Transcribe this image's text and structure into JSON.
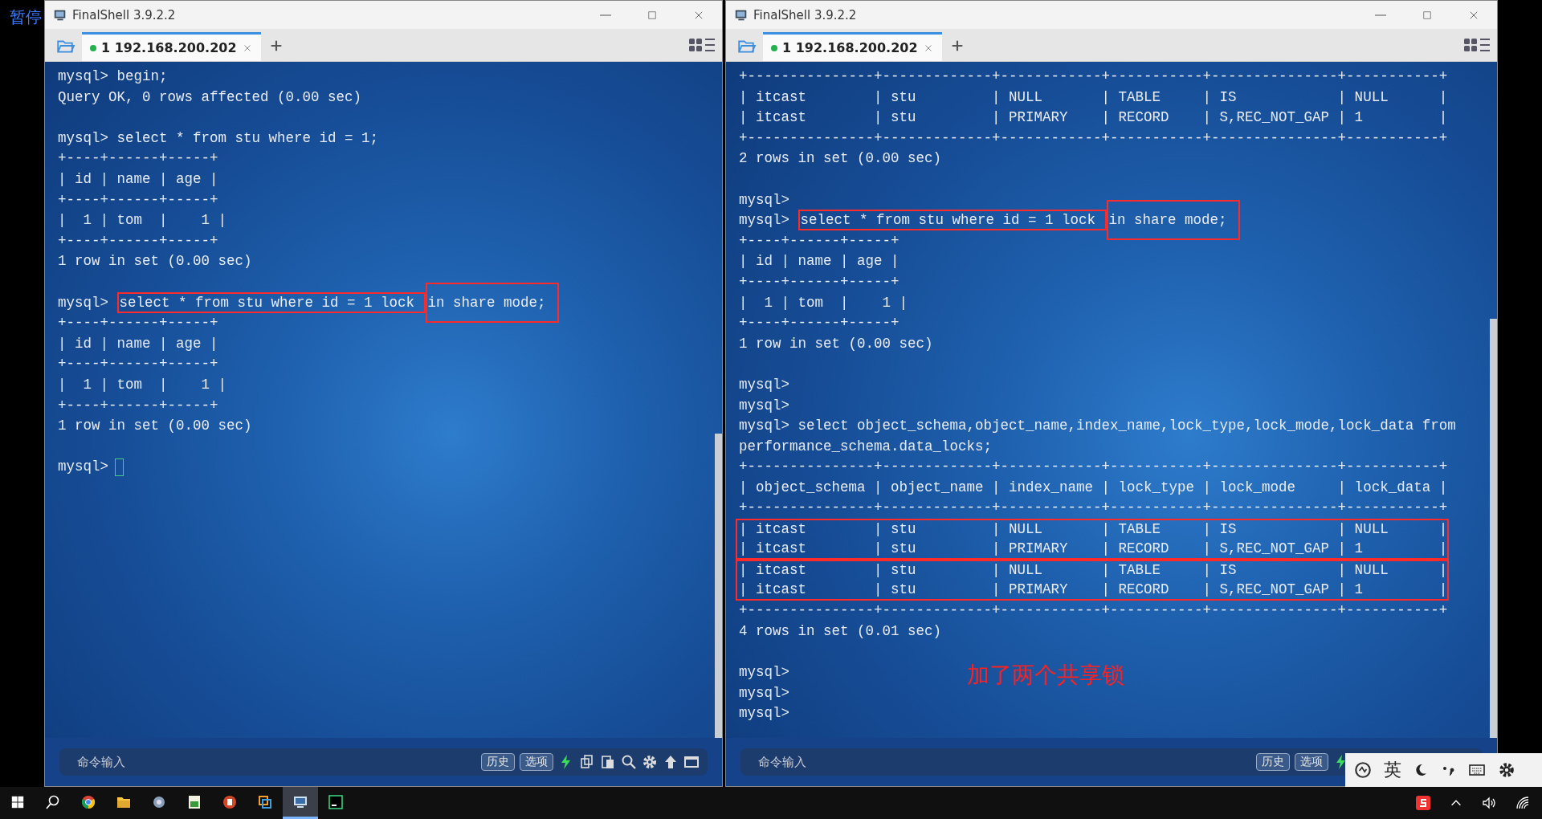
{
  "pause_label": "暂停",
  "windows": [
    {
      "title": "FinalShell 3.9.2.2",
      "tabs": [
        {
          "label": "1 192.168.200.202",
          "selected": true,
          "connected": true
        }
      ],
      "terminal": {
        "cursor": true,
        "lines": [
          {
            "kind": "text",
            "text": "mysql> begin;"
          },
          {
            "kind": "text",
            "text": "Query OK, 0 rows affected (0.00 sec)"
          },
          {
            "kind": "blank"
          },
          {
            "kind": "text",
            "text": "mysql> select * from stu where id = 1;"
          },
          {
            "kind": "text",
            "text": "+----+------+-----+"
          },
          {
            "kind": "text",
            "text": "| id | name | age |"
          },
          {
            "kind": "text",
            "text": "+----+------+-----+"
          },
          {
            "kind": "text",
            "text": "|  1 | tom  |    1 |"
          },
          {
            "kind": "text",
            "text": "+----+------+-----+"
          },
          {
            "kind": "text",
            "text": "1 row in set (0.00 sec)"
          },
          {
            "kind": "blank"
          },
          {
            "kind": "parts",
            "parts": [
              {
                "text": "mysql> ",
                "kind": "plain"
              },
              {
                "text": "select * from stu where id = 1 lock ",
                "kind": "box"
              },
              {
                "text": "in share mode;",
                "kind": "tall"
              }
            ]
          },
          {
            "kind": "text",
            "text": "+----+------+-----+"
          },
          {
            "kind": "text",
            "text": "| id | name | age |"
          },
          {
            "kind": "text",
            "text": "+----+------+-----+"
          },
          {
            "kind": "text",
            "text": "|  1 | tom  |    1 |"
          },
          {
            "kind": "text",
            "text": "+----+------+-----+"
          },
          {
            "kind": "text",
            "text": "1 row in set (0.00 sec)"
          },
          {
            "kind": "blank"
          },
          {
            "kind": "text",
            "text": "mysql>"
          }
        ]
      },
      "command_bar": {
        "placeholder": "命令输入",
        "buttons": [
          "历史",
          "选项"
        ]
      }
    },
    {
      "title": "FinalShell 3.9.2.2",
      "tabs": [
        {
          "label": "1 192.168.200.202",
          "selected": true,
          "connected": true
        }
      ],
      "terminal": {
        "annotation": "加了两个共享锁",
        "lines": [
          {
            "kind": "text",
            "text": "+---------------+-------------+------------+-----------+---------------+-----------+"
          },
          {
            "kind": "text",
            "text": "| itcast        | stu         | NULL       | TABLE     | IS            | NULL      |"
          },
          {
            "kind": "text",
            "text": "| itcast        | stu         | PRIMARY    | RECORD    | S,REC_NOT_GAP | 1         |"
          },
          {
            "kind": "text",
            "text": "+---------------+-------------+------------+-----------+---------------+-----------+"
          },
          {
            "kind": "text",
            "text": "2 rows in set (0.00 sec)"
          },
          {
            "kind": "blank"
          },
          {
            "kind": "text",
            "text": "mysql>"
          },
          {
            "kind": "parts",
            "parts": [
              {
                "text": "mysql> ",
                "kind": "plain"
              },
              {
                "text": "select * from stu where id = 1 lock ",
                "kind": "box"
              },
              {
                "text": "in share mode;",
                "kind": "tall"
              }
            ]
          },
          {
            "kind": "text",
            "text": "+----+------+-----+"
          },
          {
            "kind": "text",
            "text": "| id | name | age |"
          },
          {
            "kind": "text",
            "text": "+----+------+-----+"
          },
          {
            "kind": "text",
            "text": "|  1 | tom  |    1 |"
          },
          {
            "kind": "text",
            "text": "+----+------+-----+"
          },
          {
            "kind": "text",
            "text": "1 row in set (0.00 sec)"
          },
          {
            "kind": "blank"
          },
          {
            "kind": "text",
            "text": "mysql>"
          },
          {
            "kind": "text",
            "text": "mysql>"
          },
          {
            "kind": "text",
            "text": "mysql> select object_schema,object_name,index_name,lock_type,lock_mode,lock_data from"
          },
          {
            "kind": "text",
            "text": "performance_schema.data_locks;"
          },
          {
            "kind": "text",
            "text": "+---------------+-------------+------------+-----------+---------------+-----------+"
          },
          {
            "kind": "text",
            "text": "| object_schema | object_name | index_name | lock_type | lock_mode     | lock_data |"
          },
          {
            "kind": "text",
            "text": "+---------------+-------------+------------+-----------+---------------+-----------+"
          },
          {
            "kind": "boxed",
            "lines": [
              {
                "kind": "text",
                "text": "| itcast        | stu         | NULL       | TABLE     | IS            | NULL      |"
              },
              {
                "kind": "text",
                "text": "| itcast        | stu         | PRIMARY    | RECORD    | S,REC_NOT_GAP | 1         |"
              }
            ]
          },
          {
            "kind": "boxed",
            "lines": [
              {
                "kind": "text",
                "text": "| itcast        | stu         | NULL       | TABLE     | IS            | NULL      |"
              },
              {
                "kind": "text",
                "text": "| itcast        | stu         | PRIMARY    | RECORD    | S,REC_NOT_GAP | 1         |"
              }
            ]
          },
          {
            "kind": "text",
            "text": "+---------------+-------------+------------+-----------+---------------+-----------+"
          },
          {
            "kind": "text",
            "text": "4 rows in set (0.01 sec)"
          },
          {
            "kind": "blank"
          },
          {
            "kind": "text",
            "text": "mysql>"
          },
          {
            "kind": "text",
            "text": "mysql>"
          },
          {
            "kind": "text",
            "text": "mysql>"
          }
        ]
      },
      "command_bar": {
        "placeholder": "命令输入",
        "buttons": [
          "历史",
          "选项"
        ]
      }
    }
  ],
  "ime_toolbar": {
    "mode": "英"
  },
  "taskbar": {
    "apps": [
      {
        "kind": "browser",
        "active": false
      },
      {
        "kind": "folder",
        "active": false
      },
      {
        "kind": "tool",
        "active": false
      },
      {
        "kind": "spreadsheet",
        "active": false
      },
      {
        "kind": "slides",
        "active": false
      },
      {
        "kind": "boxes",
        "active": false
      },
      {
        "kind": "terminal",
        "active": true
      },
      {
        "kind": "database",
        "active": false
      }
    ]
  }
}
